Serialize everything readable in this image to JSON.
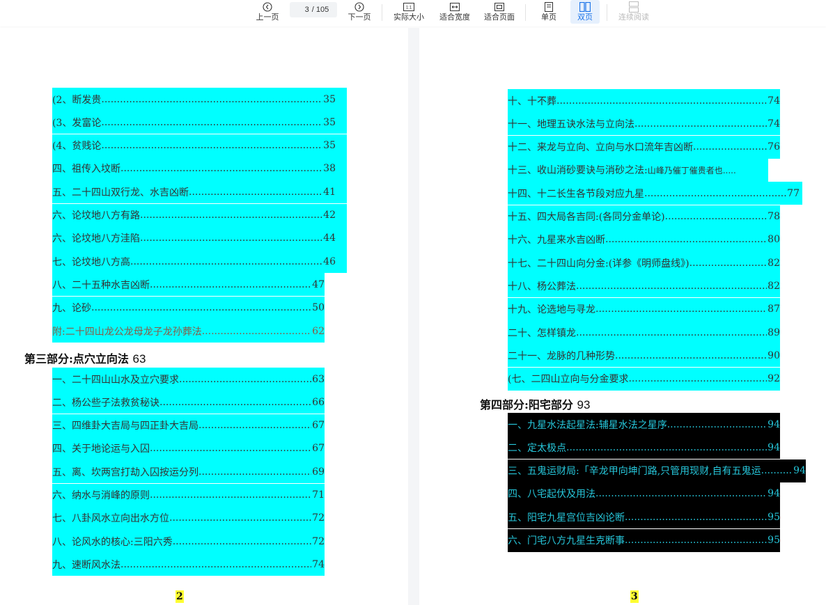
{
  "toolbar": {
    "prev_label": "上一页",
    "current_page": "3",
    "total_pages": "/ 105",
    "next_label": "下一页",
    "actual_size_label": "实际大小",
    "actual_size_icon_text": "1:1",
    "fit_width_label": "适合宽度",
    "fit_page_label": "适合页面",
    "single_page_label": "单页",
    "double_page_label": "双页",
    "continuous_label": "连续阅读"
  },
  "left_page": {
    "rows_a": [
      {
        "text": "(2、断发贵",
        "page": "35"
      },
      {
        "text": "(3、发富论",
        "page": "35"
      },
      {
        "text": "(4、贫贱论",
        "page": "35"
      },
      {
        "text": "四、祖传入坟断",
        "page": "38"
      },
      {
        "text": "五、二十四山双行龙、水吉凶断",
        "page": "41"
      },
      {
        "text": "六、论坟地八方有路",
        "page": "42"
      },
      {
        "text": "六、论坟地八方洼陷",
        "page": "44"
      },
      {
        "text": "七、论坟地八方高",
        "page": "46"
      },
      {
        "text": "八、二十五种水吉凶断",
        "page": "47"
      },
      {
        "text": "九、论砂",
        "page": "50"
      },
      {
        "text": "附:二十四山龙公龙母龙子龙孙葬法",
        "page": "62"
      }
    ],
    "heading": {
      "text": "第三部分:点穴立向法 ",
      "num": "63"
    },
    "rows_b": [
      {
        "text": "一、二十四山山水及立穴要求",
        "page": "63"
      },
      {
        "text": "二、杨公些子法救贫秘诀",
        "page": "66"
      },
      {
        "text": "三、四维卦大吉局与四正卦大吉局",
        "page": "67"
      },
      {
        "text": "四、关于地论运与入囚",
        "page": "67"
      },
      {
        "text": "五、离、坎两宫打劫入囚按运分列",
        "page": "69"
      },
      {
        "text": "六、纳水与消峰的原则",
        "page": "71"
      },
      {
        "text": "七、八卦风水立向出水方位",
        "page": "72"
      },
      {
        "text": "八、论风水的核心:三阳六秀",
        "page": "72"
      },
      {
        "text": "九、速断风水法",
        "page": "74"
      }
    ],
    "page_number": "2"
  },
  "right_page": {
    "rows_a": [
      {
        "text": "十、十不葬",
        "page": "74"
      },
      {
        "text": "十一、地理五诀水法与立向法",
        "page": "74"
      },
      {
        "text": "十二、来龙与立向、立向与水口流年吉凶断",
        "page": "76"
      },
      {
        "text": "十三、收山消砂要诀与消砂之法:",
        "small": "山峰乃催丁催贵者也.....",
        "page": ""
      },
      {
        "text": "十四、十二长生各节段对应九星",
        "page": "77"
      },
      {
        "text": "十五、四大局各吉同:(各同分金单论)",
        "page": "78"
      },
      {
        "text": "十六、九星来水吉凶断",
        "page": "80"
      },
      {
        "text": "十七、二十四山向分金:(详参《明师盘线》)",
        "page": "82"
      },
      {
        "text": "十八、杨公葬法",
        "page": "82"
      },
      {
        "text": "十九、论选地与寻龙",
        "page": "87"
      },
      {
        "text": "二十、怎样镇龙",
        "page": "89"
      },
      {
        "text": "二十一、龙脉的几种形势",
        "page": "90"
      },
      {
        "text": "(七、二四山立向与分金要求",
        "page": "92"
      }
    ],
    "heading": {
      "text": "第四部分:阳宅部分 ",
      "num": "93"
    },
    "rows_b": [
      {
        "text": "一、九星水法起星法:辅星水法之星序",
        "page": "94"
      },
      {
        "text": "二、定太极点",
        "page": "94"
      },
      {
        "text": "三、五鬼运财局:「辛龙甲向坤门路,只管用现财,自有五鬼运",
        "page": "94"
      },
      {
        "text": "四、八宅起伏及用法",
        "page": "94"
      },
      {
        "text": "五、阳宅九星宫位吉凶论断",
        "page": "95"
      },
      {
        "text": "六、门宅八方九星生克断事",
        "page": "95"
      }
    ],
    "page_number": "3"
  },
  "colors": {
    "highlight": "#00ffff",
    "dark_row": "#000000",
    "dark_text": "#26c6da",
    "page_number_bg": "#ffff33",
    "active_tab": "#1a73e8"
  },
  "icons": [
    "chevron-left-circle-icon",
    "chevron-right-circle-icon",
    "actual-size-icon",
    "fit-width-icon",
    "fit-page-icon",
    "single-page-icon",
    "double-page-icon",
    "continuous-read-icon"
  ]
}
